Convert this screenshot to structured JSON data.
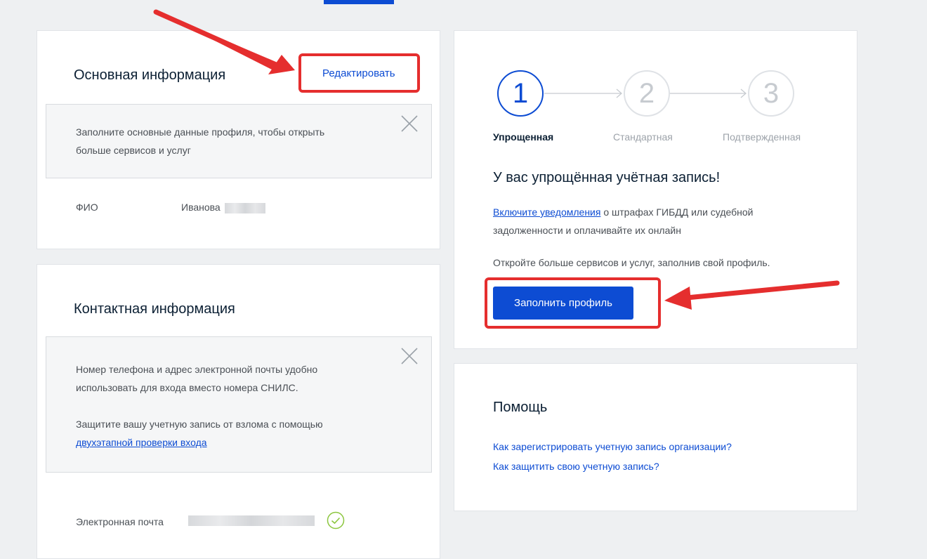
{
  "basic_info": {
    "title": "Основная информация",
    "edit_label": "Редактировать",
    "notice_text": "Заполните основные данные профиля, чтобы открыть больше сервисов и услуг",
    "fio_label": "ФИО",
    "fio_value": "Иванова"
  },
  "contact_info": {
    "title": "Контактная информация",
    "notice_text_1": "Номер телефона и адрес электронной почты удобно использовать для входа вместо номера СНИЛС.",
    "notice_text_2": "Защитите вашу учетную запись от взлома с помощью",
    "notice_link": "двухэтапной проверки входа",
    "email_label": "Электронная почта"
  },
  "account_status": {
    "steps": [
      {
        "number": "1",
        "label": "Упрощенная",
        "active": true
      },
      {
        "number": "2",
        "label": "Стандартная",
        "active": false
      },
      {
        "number": "3",
        "label": "Подтвержденная",
        "active": false
      }
    ],
    "heading": "У вас упрощённая учётная запись!",
    "notify_link": "Включите уведомления",
    "notify_text": " о штрафах ГИБДД или судебной задолженности и оплачивайте их онлайн",
    "more_text": "Откройте больше сервисов и услуг, заполнив свой профиль.",
    "fill_button": "Заполнить профиль"
  },
  "help": {
    "title": "Помощь",
    "links": [
      "Как зарегистрировать учетную запись организации?",
      "Как защитить свою учетную запись?"
    ]
  },
  "colors": {
    "accent": "#0d4cd3",
    "annotation": "#e52e2e",
    "verified": "#8cc63f"
  }
}
